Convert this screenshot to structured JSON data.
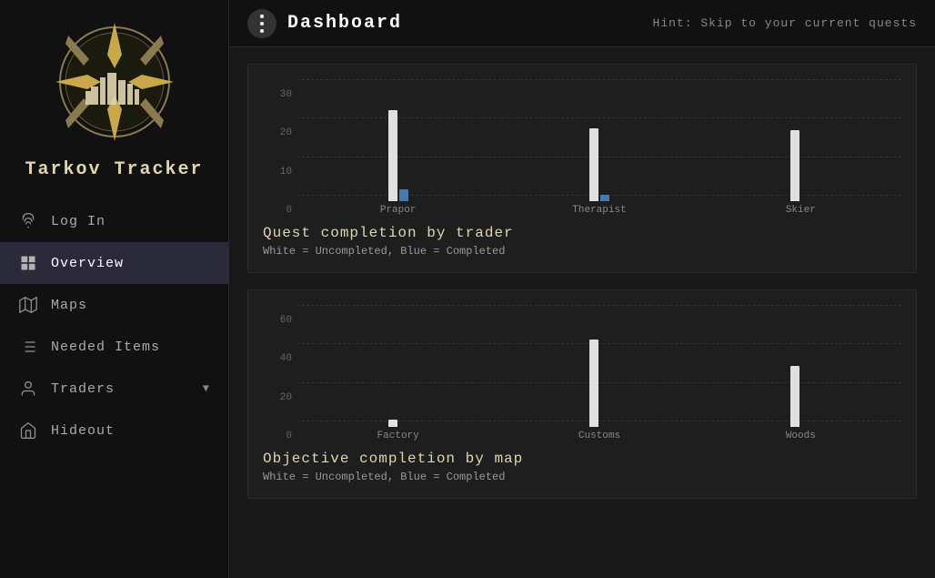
{
  "sidebar": {
    "app_title": "Tarkov Tracker",
    "nav_items": [
      {
        "id": "login",
        "label": "Log In",
        "icon": "fingerprint",
        "active": false,
        "has_arrow": false
      },
      {
        "id": "overview",
        "label": "Overview",
        "icon": "grid",
        "active": true,
        "has_arrow": false
      },
      {
        "id": "maps",
        "label": "Maps",
        "icon": "map",
        "active": false,
        "has_arrow": false
      },
      {
        "id": "needed-items",
        "label": "Needed Items",
        "icon": "list",
        "active": false,
        "has_arrow": false
      },
      {
        "id": "traders",
        "label": "Traders",
        "icon": "person",
        "active": false,
        "has_arrow": true
      },
      {
        "id": "hideout",
        "label": "Hideout",
        "icon": "home",
        "active": false,
        "has_arrow": false
      }
    ]
  },
  "topbar": {
    "page_title": "Dashboard",
    "hint": "Hint: Skip to your current quests"
  },
  "charts": [
    {
      "id": "trader-chart",
      "title": "Quest completion by trader",
      "legend": "White = Uncompleted, Blue = Completed",
      "y_labels": [
        "30",
        "20",
        "10",
        "0"
      ],
      "y_max": 30,
      "groups": [
        {
          "label": "Prapor",
          "white_pct": 75,
          "blue_pct": 10
        },
        {
          "label": "Therapist",
          "white_pct": 60,
          "blue_pct": 5
        },
        {
          "label": "Skier",
          "white_pct": 58,
          "blue_pct": 0
        }
      ]
    },
    {
      "id": "map-chart",
      "title": "Objective completion by map",
      "legend": "White = Uncompleted, Blue = Completed",
      "y_labels": [
        "60",
        "40",
        "20",
        "0"
      ],
      "y_max": 60,
      "groups": [
        {
          "label": "Factory",
          "white_pct": 6,
          "blue_pct": 0
        },
        {
          "label": "Customs",
          "white_pct": 72,
          "blue_pct": 0
        },
        {
          "label": "Woods",
          "white_pct": 50,
          "blue_pct": 0
        }
      ]
    }
  ]
}
